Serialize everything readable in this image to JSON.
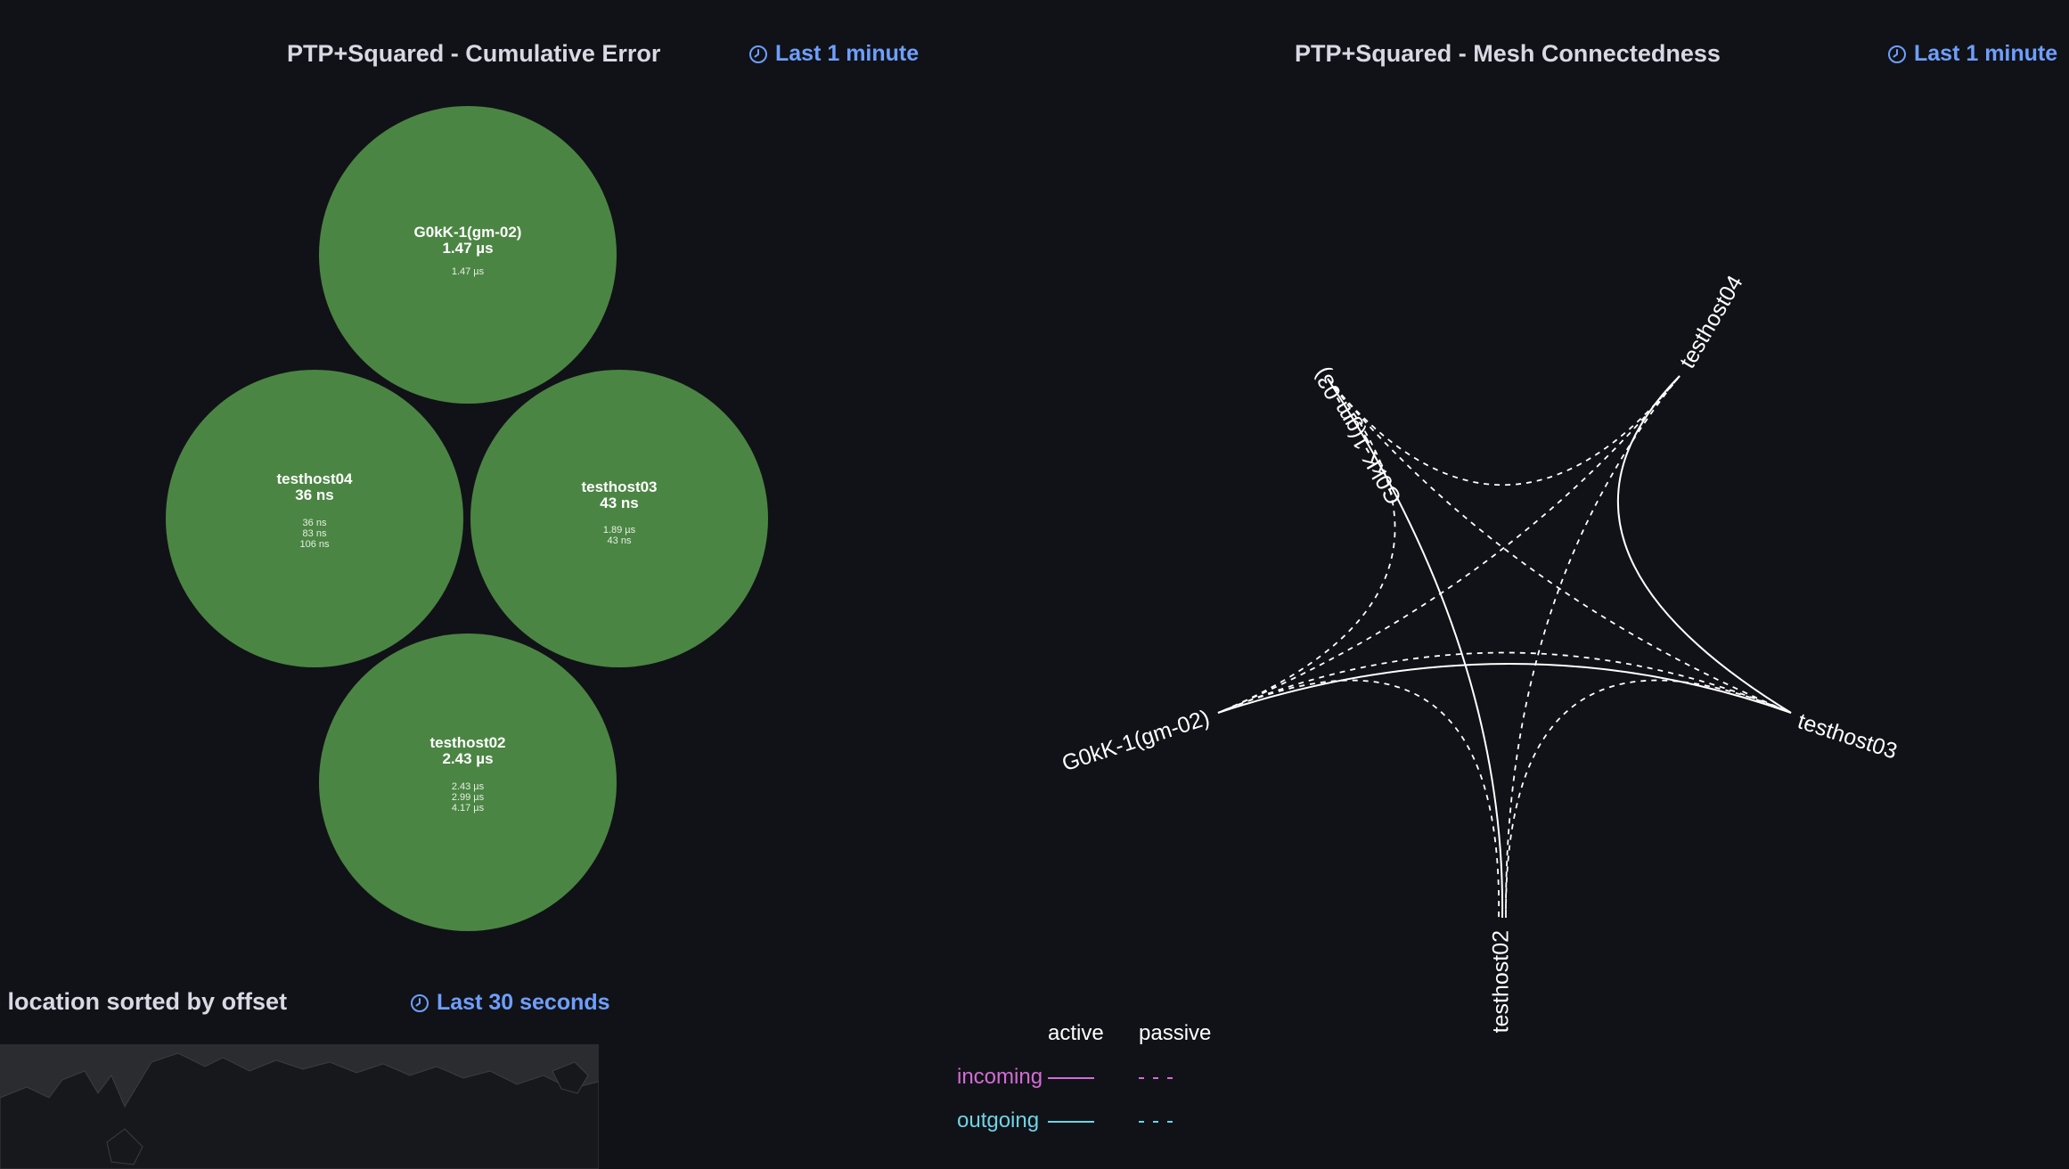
{
  "panels": {
    "cumulative": {
      "title": "PTP+Squared - Cumulative Error",
      "time_range": "Last 1 minute",
      "nodes": [
        {
          "name": "G0kK-1(gm-02)",
          "value": "1.47 µs",
          "details": [
            "1.47 µs"
          ]
        },
        {
          "name": "testhost04",
          "value": "36 ns",
          "details": [
            "36 ns",
            "83 ns",
            "106 ns"
          ]
        },
        {
          "name": "testhost03",
          "value": "43 ns",
          "details": [
            "1.89 µs",
            "43 ns"
          ]
        },
        {
          "name": "testhost02",
          "value": "2.43 µs",
          "details": [
            "2.43 µs",
            "2.99 µs",
            "4.17 µs"
          ]
        }
      ]
    },
    "mesh": {
      "title": "PTP+Squared - Mesh Connectedness",
      "time_range": "Last 1 minute",
      "nodes": [
        "G0kK-1(gm-03)",
        "testhost04",
        "testhost03",
        "testhost02",
        "G0kK-1(gm-02)"
      ],
      "legend": {
        "col_active": "active",
        "col_passive": "passive",
        "row_incoming": "incoming",
        "row_outgoing": "outgoing",
        "incoming_color": "#d36bd6",
        "outgoing_color": "#6fd3e6"
      }
    },
    "location": {
      "title": "location sorted by offset",
      "time_range": "Last 30 seconds"
    }
  },
  "colors": {
    "bubble": "#4b8543",
    "link": "#6e9fff",
    "background": "#111217"
  }
}
